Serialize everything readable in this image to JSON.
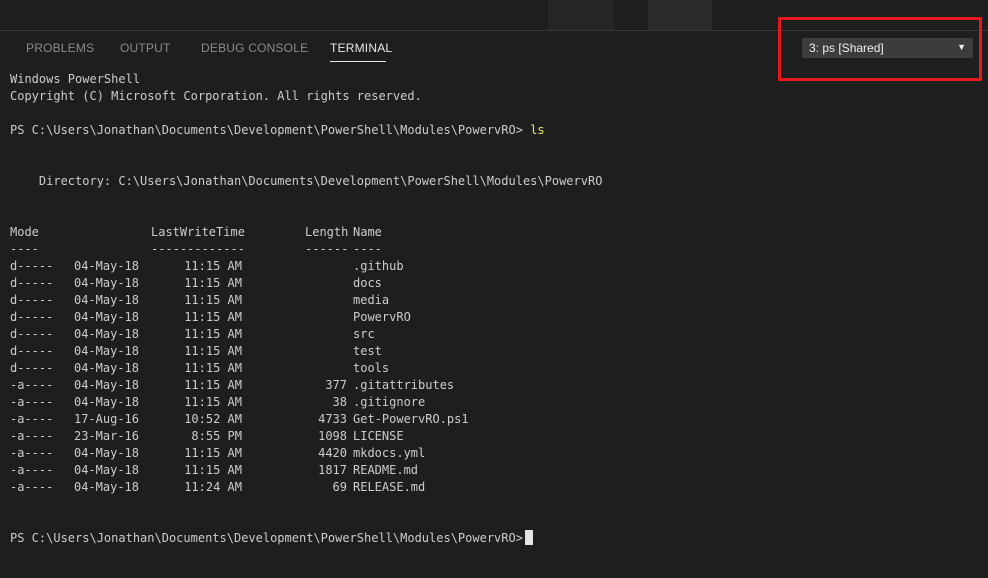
{
  "panel": {
    "tabs": [
      {
        "label": "PROBLEMS"
      },
      {
        "label": "OUTPUT"
      },
      {
        "label": "DEBUG CONSOLE"
      },
      {
        "label": "TERMINAL"
      }
    ],
    "active_tab": "TERMINAL",
    "terminal_select": {
      "value": "3: ps [Shared]",
      "caret": "▼"
    }
  },
  "terminal": {
    "banner": [
      "Windows PowerShell",
      "Copyright (C) Microsoft Corporation. All rights reserved."
    ],
    "prompt": "PS C:\\Users\\Jonathan\\Documents\\Development\\PowerShell\\Modules\\PowervRO>",
    "command": "ls",
    "directory_label": "    Directory: C:\\Users\\Jonathan\\Documents\\Development\\PowerShell\\Modules\\PowervRO",
    "listing": {
      "headers": {
        "mode": "Mode",
        "lastwrite": "LastWriteTime",
        "length": "Length",
        "name": "Name"
      },
      "dividers": {
        "mode": "----",
        "lastwrite": "-------------",
        "length": "------",
        "name": "----"
      },
      "rows": [
        {
          "mode": "d-----",
          "date": "04-May-18",
          "time": "11:15 AM",
          "length": "",
          "name": ".github"
        },
        {
          "mode": "d-----",
          "date": "04-May-18",
          "time": "11:15 AM",
          "length": "",
          "name": "docs"
        },
        {
          "mode": "d-----",
          "date": "04-May-18",
          "time": "11:15 AM",
          "length": "",
          "name": "media"
        },
        {
          "mode": "d-----",
          "date": "04-May-18",
          "time": "11:15 AM",
          "length": "",
          "name": "PowervRO"
        },
        {
          "mode": "d-----",
          "date": "04-May-18",
          "time": "11:15 AM",
          "length": "",
          "name": "src"
        },
        {
          "mode": "d-----",
          "date": "04-May-18",
          "time": "11:15 AM",
          "length": "",
          "name": "test"
        },
        {
          "mode": "d-----",
          "date": "04-May-18",
          "time": "11:15 AM",
          "length": "",
          "name": "tools"
        },
        {
          "mode": "-a----",
          "date": "04-May-18",
          "time": "11:15 AM",
          "length": "377",
          "name": ".gitattributes"
        },
        {
          "mode": "-a----",
          "date": "04-May-18",
          "time": "11:15 AM",
          "length": "38",
          "name": ".gitignore"
        },
        {
          "mode": "-a----",
          "date": "17-Aug-16",
          "time": "10:52 AM",
          "length": "4733",
          "name": "Get-PowervRO.ps1"
        },
        {
          "mode": "-a----",
          "date": "23-Mar-16",
          "time": "8:55 PM",
          "length": "1098",
          "name": "LICENSE"
        },
        {
          "mode": "-a----",
          "date": "04-May-18",
          "time": "11:15 AM",
          "length": "4420",
          "name": "mkdocs.yml"
        },
        {
          "mode": "-a----",
          "date": "04-May-18",
          "time": "11:15 AM",
          "length": "1817",
          "name": "README.md"
        },
        {
          "mode": "-a----",
          "date": "04-May-18",
          "time": "11:24 AM",
          "length": "69",
          "name": "RELEASE.md"
        }
      ]
    },
    "final_prompt": "PS C:\\Users\\Jonathan\\Documents\\Development\\PowerShell\\Modules\\PowervRO>"
  },
  "colors": {
    "background": "#1e1e1e",
    "text": "#cccccc",
    "command": "#e9e965",
    "highlight": "#e5181e",
    "active_tab": "#e8e8e8",
    "inactive_tab": "#8a8a8a"
  }
}
